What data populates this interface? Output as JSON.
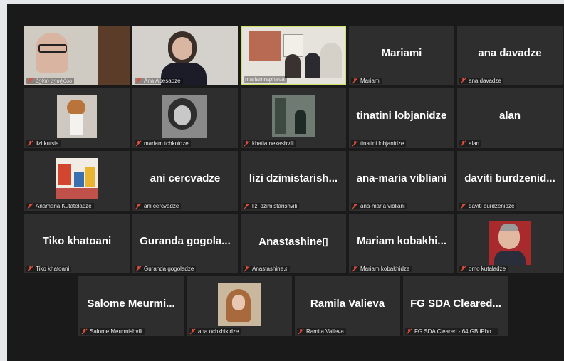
{
  "participants": [
    {
      "name": "ბერი ლიტბაა",
      "display": ""
    },
    {
      "name": "Ana Abesadze",
      "display": ""
    },
    {
      "name": "mariamraphava",
      "display": "",
      "active": true
    },
    {
      "name": "Mariami",
      "display": "Mariami"
    },
    {
      "name": "ana davadze",
      "display": "ana davadze"
    },
    {
      "name": "lizi kutsia",
      "display": ""
    },
    {
      "name": "mariam tchkoidze",
      "display": ""
    },
    {
      "name": "khatia nekashvili",
      "display": ""
    },
    {
      "name": "tinatini lobjanidze",
      "display": "tinatini lobjanidze"
    },
    {
      "name": "alan",
      "display": "alan"
    },
    {
      "name": "Anamaria Kutateladze",
      "display": ""
    },
    {
      "name": "ani cercvadze",
      "display": "ani cercvadze"
    },
    {
      "name": "lizi dzimistarishvili",
      "display": "lizi dzimistarish..."
    },
    {
      "name": "ana-maria vibliani",
      "display": "ana-maria vibliani"
    },
    {
      "name": "daviti burdzenidze",
      "display": "daviti burdzenid..."
    },
    {
      "name": "Tiko khatoani",
      "display": "Tiko khatoani"
    },
    {
      "name": "Guranda gogoladze",
      "display": "Guranda gogola..."
    },
    {
      "name": "Anastashine♫",
      "display": "Anastashine▯"
    },
    {
      "name": "Mariam kobakhidze",
      "display": "Mariam kobakhi..."
    },
    {
      "name": "omo kutaladze",
      "display": ""
    },
    {
      "name": "Salome Meurmishvili",
      "display": "Salome Meurmi..."
    },
    {
      "name": "ana ochkhikidze",
      "display": ""
    },
    {
      "name": "Ramila Valieva",
      "display": "Ramila Valieva"
    },
    {
      "name": "FG SDA Cleared - 64 GB iPho...",
      "display": "FG SDA Cleared..."
    }
  ],
  "colors": {
    "background": "#1a1a1a",
    "tile": "#2e2e2e",
    "active_border": "#cfe36b",
    "muted_mic": "#e0503a"
  }
}
